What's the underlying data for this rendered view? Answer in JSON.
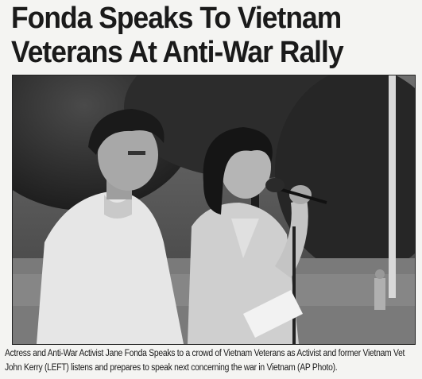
{
  "article": {
    "headline_line1": "Fonda Speaks To Vietnam",
    "headline_line2": "Veterans At Anti-War Rally",
    "caption": "Actress and Anti-War Activist Jane Fonda Speaks to a crowd of Vietnam Veterans as Activist and former Vietnam Vet John Kerry (LEFT) listens and prepares to speak next concerning the war in Vietnam (AP Photo)."
  },
  "colors": {
    "ink": "#1a1a1a",
    "paper": "#f4f4f2"
  }
}
